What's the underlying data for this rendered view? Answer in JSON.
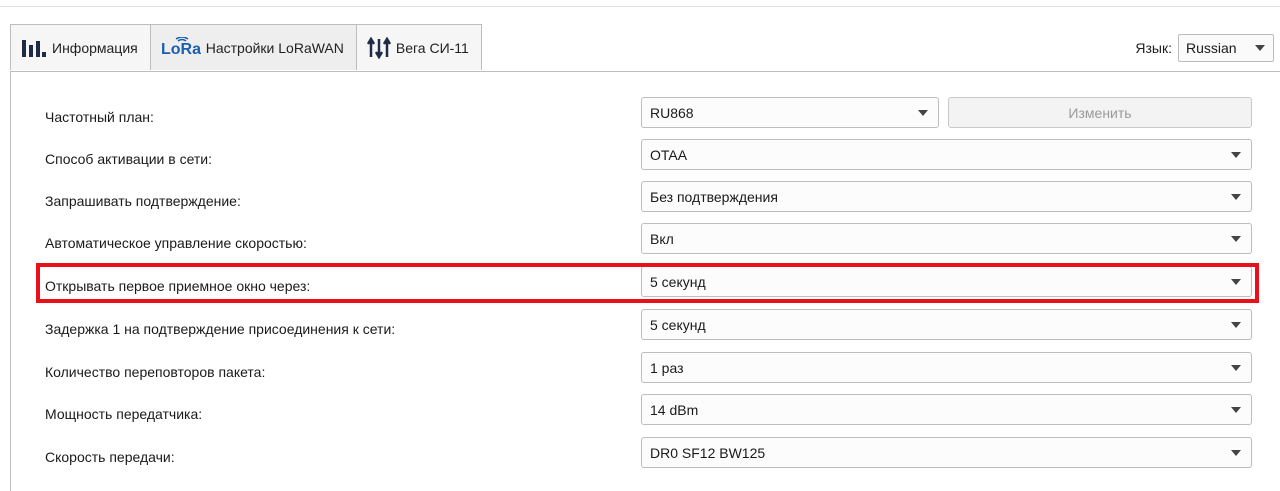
{
  "tabs": [
    {
      "label": "Информация",
      "icon": "bar-chart-icon"
    },
    {
      "label": "Настройки LoRaWAN",
      "icon": "lora-icon",
      "icon_text": "LoRa",
      "active": true
    },
    {
      "label": "Вега СИ-11",
      "icon": "arrows-updown-icon"
    }
  ],
  "language": {
    "label": "Язык:",
    "value": "Russian"
  },
  "settings": {
    "change_button": "Изменить",
    "rows": [
      {
        "label": "Частотный план:",
        "value": "RU868"
      },
      {
        "label": "Способ активации в сети:",
        "value": "OTAA"
      },
      {
        "label": "Запрашивать подтверждение:",
        "value": "Без подтверждения"
      },
      {
        "label": "Автоматическое управление скоростью:",
        "value": "Вкл"
      },
      {
        "label": "Открывать первое приемное окно через:",
        "value": "5 секунд"
      },
      {
        "label": "Задержка 1 на подтверждение присоединения к сети:",
        "value": "5 секунд"
      },
      {
        "label": "Количество переповторов пакета:",
        "value": "1 раз"
      },
      {
        "label": "Мощность передатчика:",
        "value": "14 dBm"
      },
      {
        "label": "Скорость передачи:",
        "value": "DR0 SF12 BW125"
      }
    ]
  },
  "colors": {
    "highlight": "#e8101a",
    "lora_blue": "#1b5fb0"
  }
}
